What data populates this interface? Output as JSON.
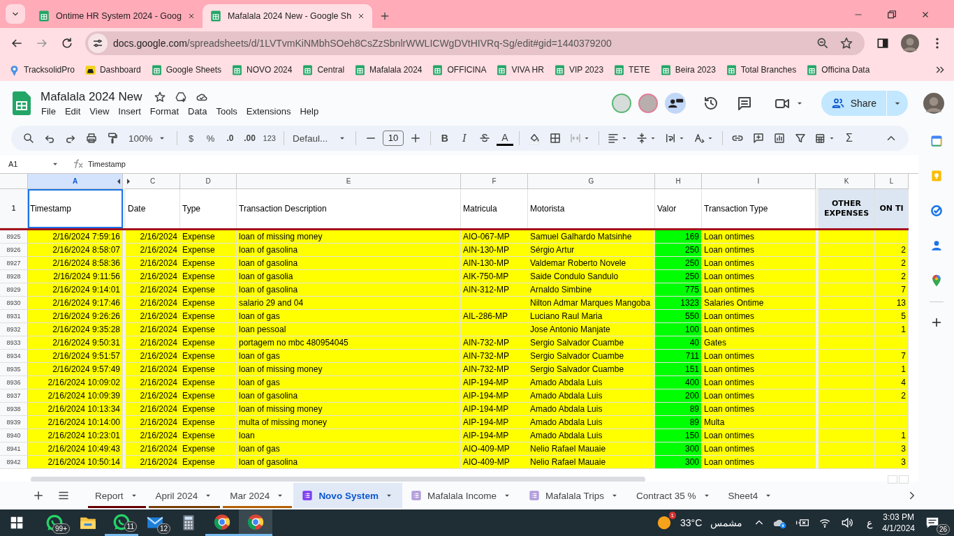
{
  "browser": {
    "tabs": [
      {
        "title": "Ontime HR System 2024 - Goog",
        "selected": false
      },
      {
        "title": "Mafalala 2024 New - Google Sh",
        "selected": true
      }
    ],
    "url": {
      "host": "docs.google.com",
      "path": "/spreadsheets/d/1LVTvmKiNMbhSOeh8CsZzSbnlrWWLICWgDVtHIVRq-Sg/edit#gid=1440379200"
    },
    "bookmarks": [
      {
        "label": "TracksolidPro",
        "kind": "pin"
      },
      {
        "label": "Dashboard",
        "kind": "taxi"
      },
      {
        "label": "Google Sheets",
        "kind": "sheets"
      },
      {
        "label": "NOVO 2024",
        "kind": "sheets"
      },
      {
        "label": "Central",
        "kind": "sheets"
      },
      {
        "label": "Mafalala 2024",
        "kind": "sheets"
      },
      {
        "label": "OFFICINA",
        "kind": "sheets"
      },
      {
        "label": "VIVA HR",
        "kind": "sheets"
      },
      {
        "label": "VIP 2023",
        "kind": "sheets"
      },
      {
        "label": "TETE",
        "kind": "sheets"
      },
      {
        "label": "Beira 2023",
        "kind": "sheets"
      },
      {
        "label": "Total Branches",
        "kind": "sheets"
      },
      {
        "label": "Officina Data",
        "kind": "sheets"
      }
    ]
  },
  "document": {
    "title": "Mafalala 2024 New",
    "menu": [
      "File",
      "Edit",
      "View",
      "Insert",
      "Format",
      "Data",
      "Tools",
      "Extensions",
      "Help"
    ],
    "share": "Share"
  },
  "toolbar": {
    "zoom": "100%",
    "currency": "$",
    "percent": "%",
    "decrease_decimal": ".0",
    "increase_decimal": ".00",
    "number_format": "123",
    "font": "Defaul...",
    "font_size": "10",
    "bold": "B",
    "italic": "I",
    "text_color": "A",
    "functions": "Σ"
  },
  "formula_bar": {
    "name_box": "A1",
    "formula": "Timestamp"
  },
  "grid": {
    "columns": [
      {
        "letter": "A",
        "selected": true,
        "color": "#ffff00"
      },
      {
        "letter": "C",
        "selected": false,
        "color": "#ffff00"
      },
      {
        "letter": "D",
        "selected": false,
        "color": "#ffff00"
      },
      {
        "letter": "E",
        "selected": false,
        "color": "#ffff00"
      },
      {
        "letter": "F",
        "selected": false,
        "color": "#ffff00"
      },
      {
        "letter": "G",
        "selected": false,
        "color": "#ffff00"
      },
      {
        "letter": "H",
        "selected": false,
        "color": "#00ff00"
      },
      {
        "letter": "I",
        "selected": false,
        "color": "#ffff00"
      },
      {
        "letter": "K",
        "selected": false,
        "color": "#ffff00"
      },
      {
        "letter": "L",
        "selected": false,
        "color": "#ffff00"
      }
    ],
    "header": {
      "number": "1",
      "cells": [
        {
          "text": "Timestamp",
          "kind": "plain"
        },
        {
          "text": "Date",
          "kind": "plain"
        },
        {
          "text": "Type",
          "kind": "plain"
        },
        {
          "text": "Transaction Description",
          "kind": "plain"
        },
        {
          "text": "Matricula",
          "kind": "plain"
        },
        {
          "text": "Motorista",
          "kind": "plain"
        },
        {
          "text": "Valor",
          "kind": "plain"
        },
        {
          "text": "Transaction Type",
          "kind": "plain"
        },
        {
          "text": "OTHER EXPENSES",
          "kind": "section"
        },
        {
          "text": "ON TI",
          "kind": "section"
        }
      ]
    },
    "rows": [
      {
        "number": "8925",
        "cells": [
          "2/16/2024 7:59:16",
          "2/16/2024",
          "Expense",
          "loan of missing money",
          "AIO-067-MP",
          "Samuel Galhardo Matsinhe",
          "169",
          "Loan ontimes",
          null,
          null
        ]
      },
      {
        "number": "8926",
        "cells": [
          "2/16/2024 8:58:07",
          "2/16/2024",
          "Expense",
          "loan of gasolina",
          "AIN-130-MP",
          "Sérgio Artur",
          "250",
          "Loan ontimes",
          null,
          "2"
        ]
      },
      {
        "number": "8927",
        "cells": [
          "2/16/2024 8:58:36",
          "2/16/2024",
          "Expense",
          "loan of gasolina",
          "AIN-130-MP",
          "Valdemar Roberto Novele",
          "250",
          "Loan ontimes",
          null,
          "2"
        ]
      },
      {
        "number": "8928",
        "cells": [
          "2/16/2024 9:11:56",
          "2/16/2024",
          "Expense",
          "loan of gasolia",
          "AIK-750-MP",
          "Saide Condulo Sandulo",
          "250",
          "Loan ontimes",
          null,
          "2"
        ]
      },
      {
        "number": "8929",
        "cells": [
          "2/16/2024 9:14:01",
          "2/16/2024",
          "Expense",
          "loan of gasolina",
          "AIN-312-MP",
          "Arnaldo Simbine",
          "775",
          "Loan ontimes",
          null,
          "7"
        ]
      },
      {
        "number": "8930",
        "cells": [
          "2/16/2024 9:17:46",
          "2/16/2024",
          "Expense",
          "salario 29 and 04",
          null,
          "Nilton Admar Marques Mangoba",
          "1323",
          "Salaries Ontime",
          null,
          "13"
        ]
      },
      {
        "number": "8931",
        "cells": [
          "2/16/2024 9:26:26",
          "2/16/2024",
          "Expense",
          "loan of gas",
          "AIL-286-MP",
          "Luciano Raul Maria",
          "550",
          "Loan ontimes",
          null,
          "5"
        ]
      },
      {
        "number": "8932",
        "cells": [
          "2/16/2024 9:35:28",
          "2/16/2024",
          "Expense",
          "loan pessoal",
          null,
          "Jose Antonio Manjate",
          "100",
          "Loan ontimes",
          null,
          "1"
        ]
      },
      {
        "number": "8933",
        "cells": [
          "2/16/2024 9:50:31",
          "2/16/2024",
          "Expense",
          "portagem no mbc 480954045",
          "AIN-732-MP",
          "Sergio Salvador Cuambe",
          "40",
          "Gates",
          null,
          null
        ]
      },
      {
        "number": "8934",
        "cells": [
          "2/16/2024 9:51:57",
          "2/16/2024",
          "Expense",
          "loan of gas",
          "AIN-732-MP",
          "Sergio Salvador Cuambe",
          "711",
          "Loan ontimes",
          null,
          "7"
        ]
      },
      {
        "number": "8935",
        "cells": [
          "2/16/2024 9:57:49",
          "2/16/2024",
          "Expense",
          "loan of missing money",
          "AIN-732-MP",
          "Sergio Salvador Cuambe",
          "151",
          "Loan ontimes",
          null,
          "1"
        ]
      },
      {
        "number": "8936",
        "cells": [
          "2/16/2024 10:09:02",
          "2/16/2024",
          "Expense",
          "loan of gas",
          "AIP-194-MP",
          "Amado Abdala Luis",
          "400",
          "Loan ontimes",
          null,
          "4"
        ]
      },
      {
        "number": "8937",
        "cells": [
          "2/16/2024 10:09:39",
          "2/16/2024",
          "Expense",
          "loan of gasolina",
          "AIP-194-MP",
          "Amado Abdala Luis",
          "200",
          "Loan ontimes",
          null,
          "2"
        ]
      },
      {
        "number": "8938",
        "cells": [
          "2/16/2024 10:13:34",
          "2/16/2024",
          "Expense",
          "loan of  missing money",
          "AIP-194-MP",
          "Amado Abdala Luis",
          "89",
          "Loan ontimes",
          null,
          null
        ]
      },
      {
        "number": "8939",
        "cells": [
          "2/16/2024 10:14:00",
          "2/16/2024",
          "Expense",
          "multa of  missing money",
          "AIP-194-MP",
          "Amado Abdala Luis",
          "89",
          "Multa",
          null,
          null
        ]
      },
      {
        "number": "8940",
        "cells": [
          "2/16/2024 10:23:01",
          "2/16/2024",
          "Expense",
          "loan",
          "AIP-194-MP",
          "Amado Abdala Luis",
          "150",
          "Loan ontimes",
          null,
          "1"
        ]
      },
      {
        "number": "8941",
        "cells": [
          "2/16/2024 10:49:43",
          "2/16/2024",
          "Expense",
          "loan of gas",
          "AIO-409-MP",
          "Nelio Rafael Mauaie",
          "300",
          "Loan ontimes",
          null,
          "3"
        ]
      },
      {
        "number": "8942",
        "cells": [
          "2/16/2024 10:50:14",
          "2/16/2024",
          "Expense",
          "loan of gasolina",
          "AIO-409-MP",
          "Nelio Rafael Mauaie",
          "300",
          "Loan ontimes",
          null,
          "3"
        ]
      }
    ]
  },
  "sheet_tabs": [
    {
      "label": "Report",
      "selected": false,
      "kind": "plain",
      "color": "#660000"
    },
    {
      "label": "April 2024",
      "selected": false,
      "kind": "plain",
      "color": "#783f04"
    },
    {
      "label": "Mar 2024",
      "selected": false,
      "kind": "plain",
      "color": "#b45f06"
    },
    {
      "label": "Novo System",
      "selected": true,
      "kind": "form"
    },
    {
      "label": "Mafalala Income",
      "selected": false,
      "kind": "form"
    },
    {
      "label": "Mafalala Trips",
      "selected": false,
      "kind": "form"
    },
    {
      "label": "Contract 35 %",
      "selected": false,
      "kind": "plain"
    },
    {
      "label": "Sheet4",
      "selected": false,
      "kind": "plain"
    }
  ],
  "taskbar": {
    "apps": [
      {
        "kind": "whatsapp",
        "badge": "99+",
        "running": false,
        "selected": false
      },
      {
        "kind": "folder",
        "running": false,
        "selected": false
      },
      {
        "kind": "whatsapp",
        "badge": "11",
        "running": true,
        "selected": false
      },
      {
        "kind": "mail",
        "badge": "12",
        "running": false,
        "selected": false
      },
      {
        "kind": "calculator",
        "running": false,
        "selected": false
      },
      {
        "kind": "chrome",
        "running": true,
        "selected": false
      },
      {
        "kind": "chrome",
        "running": true,
        "selected": true
      }
    ],
    "weather": {
      "temperature": "33°C",
      "condition": "مشمس",
      "badge": "1"
    },
    "language": "ع",
    "time": "3:03 PM",
    "date": "4/1/2024",
    "notifications": "26"
  }
}
